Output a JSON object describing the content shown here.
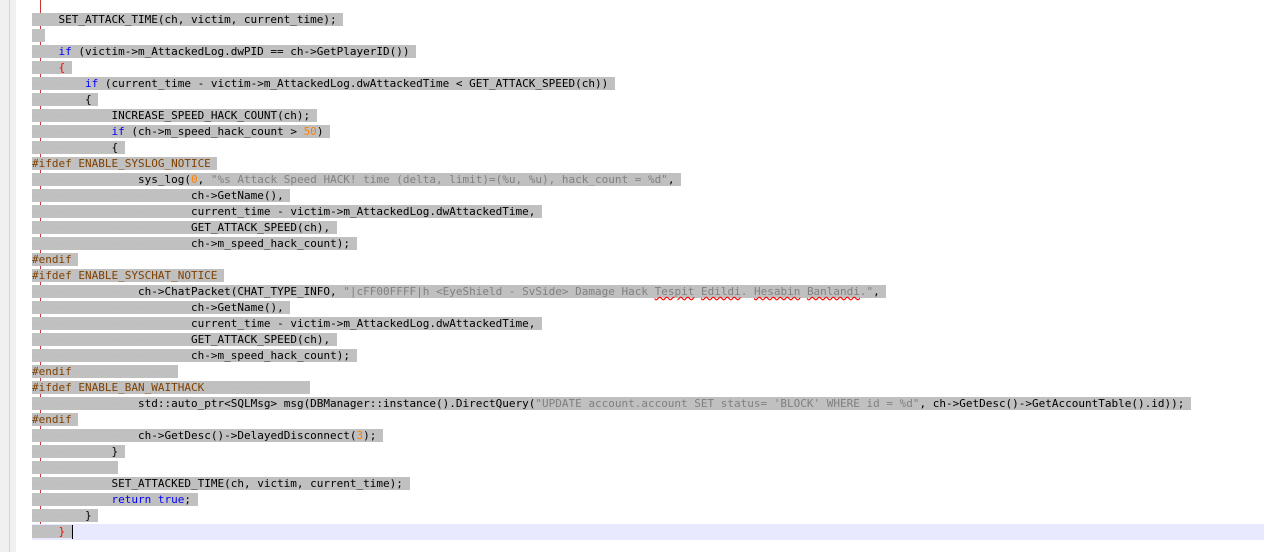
{
  "editor": {
    "lines": [
      {
        "indent": 1,
        "parts": [
          {
            "t": "SET_ATTACK_TIME(ch, victim, current_time);"
          }
        ]
      },
      {
        "indent": 0,
        "parts": [
          {
            "t": " "
          }
        ]
      },
      {
        "indent": 1,
        "parts": [
          {
            "t": "if",
            "c": "kw"
          },
          {
            "t": " (victim->m_AttackedLog.dwPID == ch->GetPlayerID())"
          }
        ]
      },
      {
        "indent": 1,
        "parts": [
          {
            "t": "{",
            "c": "brace-hi"
          }
        ]
      },
      {
        "indent": 2,
        "parts": [
          {
            "t": "if",
            "c": "kw"
          },
          {
            "t": " (current_time - victim->m_AttackedLog.dwAttackedTime < GET_ATTACK_SPEED(ch))"
          }
        ]
      },
      {
        "indent": 2,
        "parts": [
          {
            "t": "{"
          }
        ]
      },
      {
        "indent": 3,
        "parts": [
          {
            "t": "INCREASE_SPEED_HACK_COUNT(ch);"
          }
        ]
      },
      {
        "indent": 3,
        "parts": [
          {
            "t": "if",
            "c": "kw"
          },
          {
            "t": " (ch->m_speed_hack_count > "
          },
          {
            "t": "50",
            "c": "num"
          },
          {
            "t": ")"
          }
        ]
      },
      {
        "indent": 3,
        "parts": [
          {
            "t": "{"
          }
        ]
      },
      {
        "indent": 0,
        "parts": [
          {
            "t": "#ifdef ENABLE_SYSLOG_NOTICE",
            "c": "pp"
          }
        ]
      },
      {
        "indent": 4,
        "parts": [
          {
            "t": "sys_log("
          },
          {
            "t": "0",
            "c": "num"
          },
          {
            "t": ", "
          },
          {
            "t": "\"%s Attack Speed HACK! time (delta, limit)=(%u, %u), hack_count = %d\"",
            "c": "str"
          },
          {
            "t": ","
          }
        ]
      },
      {
        "indent": 6,
        "parts": [
          {
            "t": "ch->GetName(),"
          }
        ]
      },
      {
        "indent": 6,
        "parts": [
          {
            "t": "current_time - victim->m_AttackedLog.dwAttackedTime,"
          }
        ]
      },
      {
        "indent": 6,
        "parts": [
          {
            "t": "GET_ATTACK_SPEED(ch),"
          }
        ]
      },
      {
        "indent": 6,
        "parts": [
          {
            "t": "ch->m_speed_hack_count);"
          }
        ]
      },
      {
        "indent": 0,
        "parts": [
          {
            "t": "#endif",
            "c": "pp"
          }
        ]
      },
      {
        "indent": 0,
        "parts": [
          {
            "t": "#ifdef ENABLE_SYSCHAT_NOTICE",
            "c": "pp"
          }
        ]
      },
      {
        "indent": 4,
        "parts": [
          {
            "t": "ch->ChatPacket(CHAT_TYPE_INFO, "
          },
          {
            "t": "\"|cFF00FFFF|h <EyeShield - SvSide> Damage Hack ",
            "c": "str"
          },
          {
            "t": "Tespit",
            "c": "str squig"
          },
          {
            "t": " ",
            "c": "str"
          },
          {
            "t": "Edildi",
            "c": "str squig"
          },
          {
            "t": ". ",
            "c": "str"
          },
          {
            "t": "Hesabin",
            "c": "str squig"
          },
          {
            "t": " ",
            "c": "str"
          },
          {
            "t": "Banlandi",
            "c": "str squig"
          },
          {
            "t": ".\"",
            "c": "str"
          },
          {
            "t": ","
          }
        ]
      },
      {
        "indent": 6,
        "parts": [
          {
            "t": "ch->GetName(),"
          }
        ]
      },
      {
        "indent": 6,
        "parts": [
          {
            "t": "current_time - victim->m_AttackedLog.dwAttackedTime,"
          }
        ]
      },
      {
        "indent": 6,
        "parts": [
          {
            "t": "GET_ATTACK_SPEED(ch),"
          }
        ]
      },
      {
        "indent": 6,
        "parts": [
          {
            "t": "ch->m_speed_hack_count);"
          }
        ]
      },
      {
        "indent": 0,
        "parts": [
          {
            "t": "#endif",
            "c": "pp"
          }
        ],
        "trail": 4
      },
      {
        "indent": 0,
        "parts": [
          {
            "t": "#ifdef ENABLE_BAN_WAITHACK",
            "c": "pp"
          }
        ],
        "trail": 4
      },
      {
        "indent": 4,
        "parts": [
          {
            "t": "std::auto_ptr<SQLMsg> msg(DBManager::instance().DirectQuery("
          },
          {
            "t": "\"UPDATE account.account SET status= 'BLOCK' WHERE id = %d\"",
            "c": "str"
          },
          {
            "t": ", ch->GetDesc()->GetAccountTable().id));"
          }
        ]
      },
      {
        "indent": 0,
        "parts": [
          {
            "t": "#endif",
            "c": "pp"
          }
        ]
      },
      {
        "indent": 4,
        "parts": [
          {
            "t": "ch->GetDesc()->DelayedDisconnect("
          },
          {
            "t": "3",
            "c": "num"
          },
          {
            "t": ");"
          }
        ]
      },
      {
        "indent": 3,
        "parts": [
          {
            "t": "}"
          }
        ]
      },
      {
        "indent": 3,
        "parts": [
          {
            "t": ""
          }
        ]
      },
      {
        "indent": 3,
        "parts": [
          {
            "t": "SET_ATTACKED_TIME(ch, victim, current_time);"
          }
        ]
      },
      {
        "indent": 3,
        "parts": [
          {
            "t": "return true",
            "c": "kw"
          },
          {
            "t": ";"
          }
        ]
      },
      {
        "indent": 2,
        "parts": [
          {
            "t": "}"
          }
        ]
      },
      {
        "indent": 1,
        "parts": [
          {
            "t": "}",
            "c": "brace-hi"
          }
        ],
        "current": true,
        "caret": true
      }
    ]
  }
}
